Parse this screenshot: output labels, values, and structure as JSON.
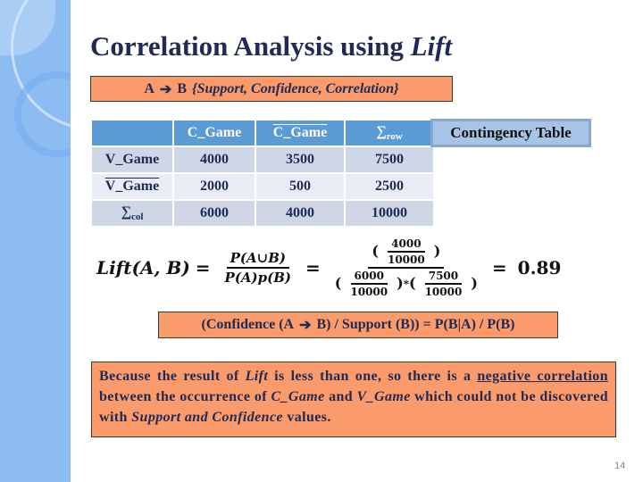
{
  "title": {
    "main": "Correlation Analysis using ",
    "italic": "Lift"
  },
  "rule_box": {
    "a": "A",
    "arrow_icon": "right-arrow",
    "b": "B",
    "measures": "{Support, Confidence, Correlation}"
  },
  "contingency_label": "Contingency Table",
  "table": {
    "headers": [
      "",
      "C_Game",
      "C_Game",
      "∑"
    ],
    "header_overline": [
      false,
      false,
      true,
      false
    ],
    "row_sum_sub": "row",
    "rows": [
      {
        "label": "V_Game",
        "overline": false,
        "values": [
          "4000",
          "3500",
          "7500"
        ]
      },
      {
        "label": "V_Game",
        "overline": true,
        "values": [
          "2000",
          "500",
          "2500"
        ]
      },
      {
        "label": "∑",
        "sub": "col",
        "values": [
          "6000",
          "4000",
          "10000"
        ]
      }
    ]
  },
  "formula": {
    "lhs": "Lift(A, B)",
    "eq": "=",
    "frac1_num": "P(A∪B)",
    "frac1_den": "P(A)p(B)",
    "frac2_num_num": "4000",
    "frac2_num_den": "10000",
    "frac2_den_a_num": "6000",
    "frac2_den_a_den": "10000",
    "times": "*",
    "frac2_den_b_num": "7500",
    "frac2_den_b_den": "10000",
    "result": "0.89"
  },
  "definition_box": {
    "text_before": "(Confidence (A ",
    "text_after": " B) / Support (B)) = P(B|A) / P(B)"
  },
  "conclusion": {
    "p1": "Because the result of ",
    "lift": "Lift",
    "p2": " is less than one, so there is a ",
    "neg_corr": "negative correlation",
    "p3": " between the occurrence of ",
    "cgame": "C_Game",
    "p4": " and ",
    "vgame": "V_Game",
    "p5": " which could not be discovered with ",
    "sc": "Support and Confidence",
    "p6": " values."
  },
  "page_number": "14",
  "colors": {
    "orange": "#fb9a6b",
    "header_blue": "#5b9bd5",
    "title_navy": "#1f2a55",
    "sidebar": "#8cbcf2"
  }
}
